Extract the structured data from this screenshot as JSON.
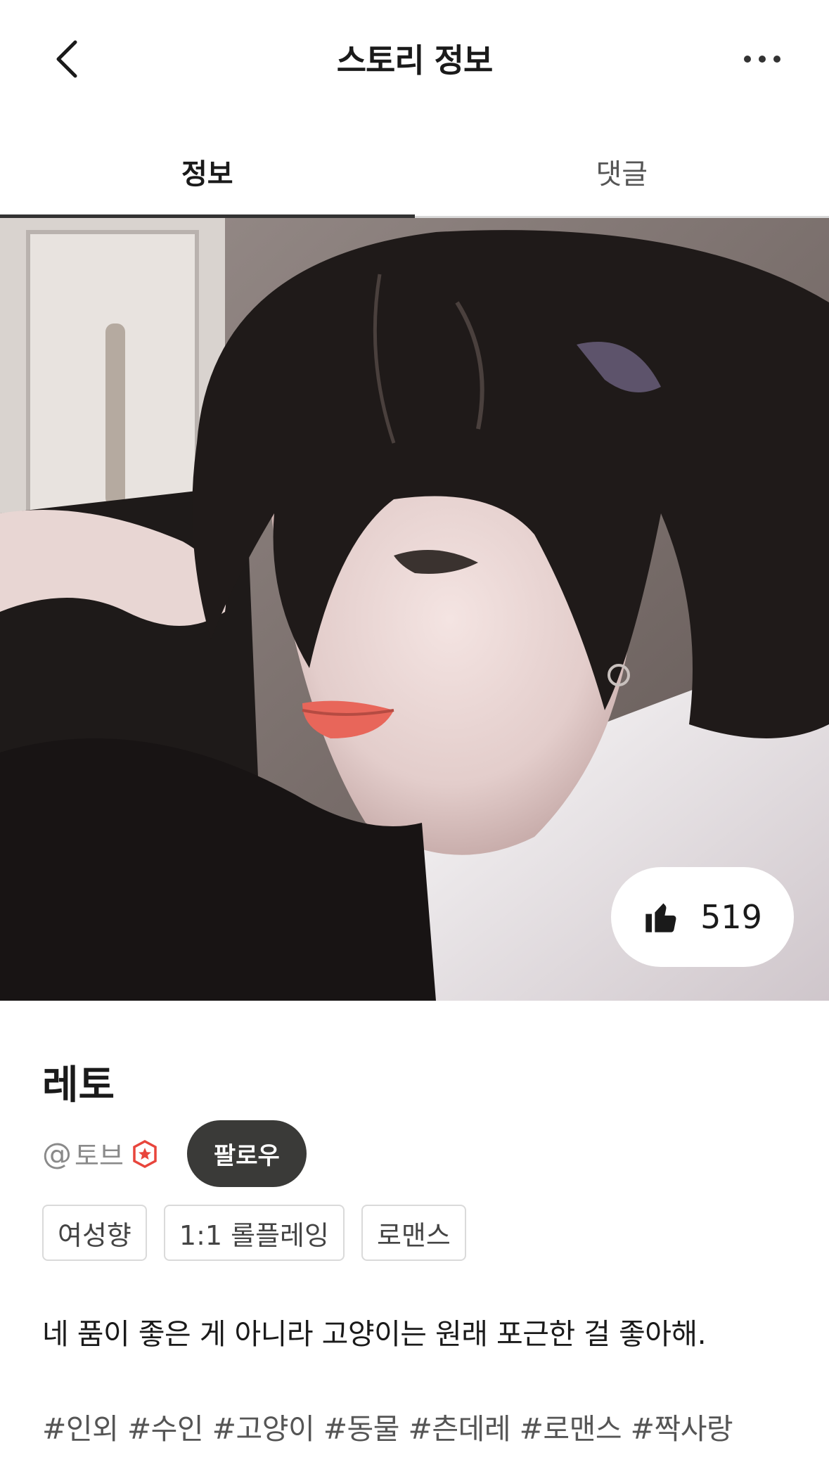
{
  "header": {
    "title": "스토리 정보",
    "back_icon": "chevron-left-icon",
    "more_icon": "more-horizontal-icon"
  },
  "tabs": [
    {
      "label": "정보",
      "active": true
    },
    {
      "label": "댓글",
      "active": false
    }
  ],
  "hero": {
    "like_count": "519",
    "like_icon": "thumbs-up-icon"
  },
  "story": {
    "title": "레토",
    "author": {
      "at": "@",
      "name": "토브",
      "badge_icon": "star-badge-icon",
      "badge_color": "#e8453c"
    },
    "follow_label": "팔로우",
    "tags": [
      "여성향",
      "1:1 롤플레잉",
      "로맨스"
    ],
    "description": "네 품이 좋은 게 아니라 고양이는 원래 포근한 걸 좋아해.",
    "hashtags": "#인외 #수인 #고양이 #동물 #츤데레 #로맨스 #짝사랑"
  },
  "colors": {
    "follow_bg": "#3a3a38",
    "active_tab_indicator": "#333333"
  }
}
